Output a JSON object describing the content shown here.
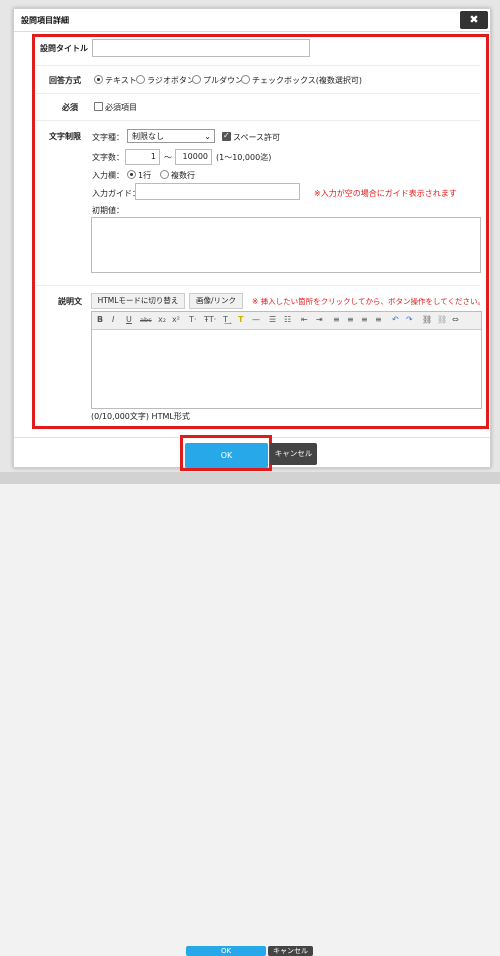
{
  "dialog": {
    "title": "設問項目詳細",
    "close_label": "✖"
  },
  "form": {
    "question_title": {
      "label": "設問タイトル",
      "value": ""
    },
    "answer_type": {
      "label": "回答方式",
      "options": [
        "テキスト",
        "ラジオボタン",
        "プルダウン",
        "チェックボックス(複数選択可)"
      ],
      "selected": "テキスト"
    },
    "required": {
      "label": "必須",
      "checkbox_label": "必須項目"
    },
    "char_limit": {
      "label": "文字制限",
      "type_label": "文字種：",
      "type_value": "制限なし",
      "space_label": "スペース許可",
      "count_label": "文字数：",
      "min": "1",
      "tilde": "〜",
      "max": "10000",
      "range_note": "(1〜10,000迄)",
      "input_field_label": "入力欄：",
      "input_field_options": [
        "1行",
        "複数行"
      ],
      "input_field_selected": "1行",
      "guide_label": "入力ガイド：",
      "guide_value": "",
      "guide_note": "※入力が空の場合にガイド表示されます",
      "initial_label": "初期値：",
      "initial_value": ""
    },
    "description": {
      "label": "説明文",
      "html_mode_button": "HTMLモードに切り替え",
      "image_link_button": "画像/リンク",
      "hint": "※ 挿入したい箇所をクリックしてから、ボタン操作をしてください。",
      "toolbar": [
        "B",
        "I",
        "U",
        "abc",
        "x₂",
        "x²",
        "T·",
        "ŦT·",
        "T͢",
        "T",
        "—",
        "☰",
        "☷",
        "⇤",
        "⇥",
        "≡",
        "≡",
        "≡",
        "≡",
        "↶",
        "↷",
        "⛓",
        "⛓",
        "⇔"
      ],
      "counter": "(0/10,000文字) HTML形式"
    }
  },
  "footer": {
    "ok_label": "OK",
    "cancel_label": "キャンセル"
  },
  "background": {
    "ok_label": "OK",
    "cancel_label": "キャンセル"
  },
  "colors": {
    "accent": "#27a8e8",
    "highlight": "#e01b1b",
    "dark": "#333333"
  }
}
